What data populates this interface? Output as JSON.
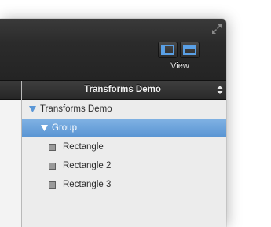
{
  "toolbar": {
    "view_label": "View",
    "fullscreen_icon": "fullscreen-expand-icon",
    "view_buttons": [
      {
        "icon": "left-panel-layout-icon"
      },
      {
        "icon": "top-panel-layout-icon"
      }
    ],
    "accent_color": "#5aa0e6"
  },
  "inspector": {
    "header_title": "Transforms Demo",
    "tree": [
      {
        "label": "Transforms Demo",
        "level": 0,
        "icon": "disclosure-triangle-icon",
        "selected": false
      },
      {
        "label": "Group",
        "level": 1,
        "icon": "disclosure-triangle-icon",
        "selected": true
      },
      {
        "label": "Rectangle",
        "level": 2,
        "icon": "rectangle-icon",
        "selected": false
      },
      {
        "label": "Rectangle 2",
        "level": 2,
        "icon": "rectangle-icon",
        "selected": false
      },
      {
        "label": "Rectangle 3",
        "level": 2,
        "icon": "rectangle-icon",
        "selected": false
      }
    ],
    "selection_color": "#6aa3dc"
  }
}
